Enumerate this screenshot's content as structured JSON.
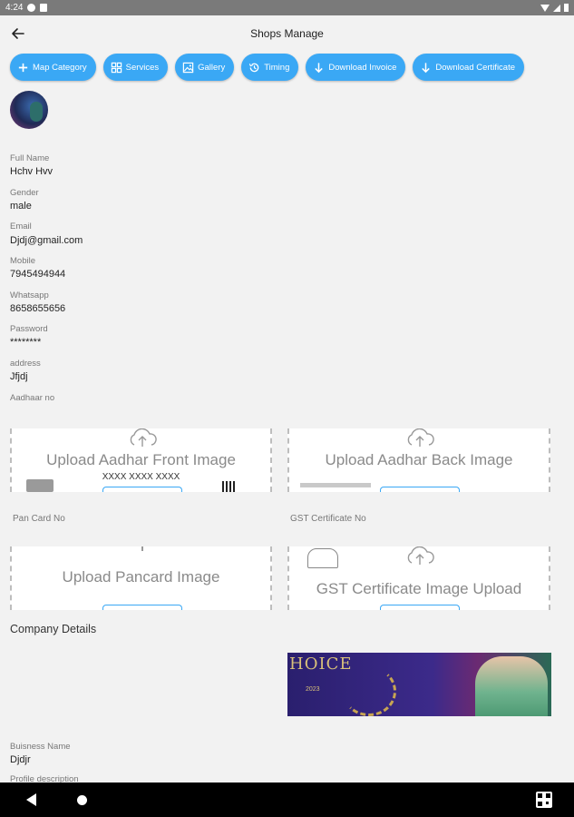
{
  "status_bar": {
    "time": "4:24"
  },
  "header": {
    "title": "Shops Manage"
  },
  "actions": [
    {
      "label": "Map Category",
      "icon": "plus-icon"
    },
    {
      "label": "Services",
      "icon": "grid-icon"
    },
    {
      "label": "Gallery",
      "icon": "image-icon"
    },
    {
      "label": "Timing",
      "icon": "history-icon"
    },
    {
      "label": "Download Invoice",
      "icon": "arrow-down-icon"
    },
    {
      "label": "Download Certificate",
      "icon": "arrow-down-icon"
    }
  ],
  "profile": {
    "full_name_label": "Full Name",
    "full_name": "Hchv Hvv",
    "gender_label": "Gender",
    "gender": "male",
    "email_label": "Email",
    "email": "Djdj@gmail.com",
    "mobile_label": "Mobile",
    "mobile": "7945494944",
    "whatsapp_label": "Whatsapp",
    "whatsapp": "8658655656",
    "password_label": "Password",
    "password": "********",
    "address_label": "address",
    "address": "Jfjdj",
    "aadhaar_label": "Aadhaar no"
  },
  "uploads": {
    "aadhar_front": "Upload Aadhar Front Image",
    "aadhar_front_masked": "XXXX XXXX XXXX",
    "aadhar_back": "Upload Aadhar Back Image",
    "pan_label": "Pan Card No",
    "gst_label": "GST Certificate No",
    "pancard": "Upload Pancard Image",
    "gst": "GST Certificate Image Upload"
  },
  "company": {
    "section_title": "Company Details",
    "banner_text": "HOICE",
    "banner_year": "2023",
    "business_name_label": "Buisness Name",
    "business_name": "Djdjr",
    "profile_description_label": "Profile description"
  },
  "colors": {
    "accent": "#3aa8f5",
    "status_bar": "#7a7a7a",
    "background": "#f2f2f2"
  }
}
